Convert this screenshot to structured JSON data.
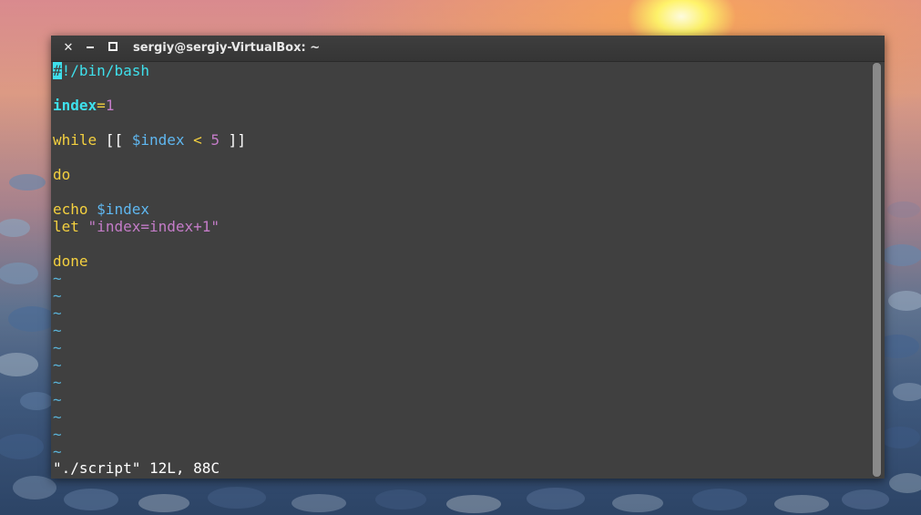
{
  "window": {
    "title": "sergiy@sergiy-VirtualBox: ~",
    "close_label": "✕"
  },
  "code": {
    "shebang_cursor": "#",
    "shebang_rest": "!/bin/bash",
    "assign_var": "index",
    "assign_eq": "=",
    "assign_val": "1",
    "while_kw": "while",
    "while_open": " [[ ",
    "while_var": "$index",
    "while_op": " < ",
    "while_num": "5",
    "while_close": " ]]",
    "do_kw": "do",
    "echo_kw": "echo",
    "echo_var": "$index",
    "let_kw": "let",
    "let_str": "\"index=index+1\"",
    "done_kw": "done"
  },
  "tilde_char": "~",
  "status_line": "\"./script\" 12L, 88C",
  "colors": {
    "keyword": "#f4d03f",
    "variable": "#3ee0ec",
    "number_string": "#c47cc8",
    "terminal_bg": "#404040"
  }
}
